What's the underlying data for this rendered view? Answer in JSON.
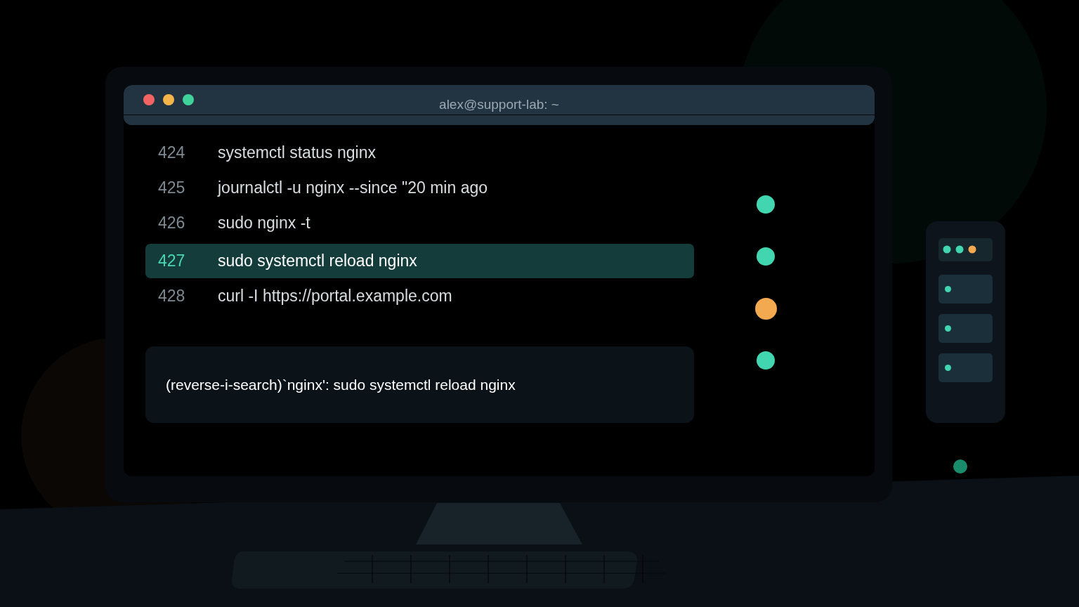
{
  "window": {
    "title": "alex@support-lab: ~"
  },
  "history": [
    {
      "number": "424",
      "command": "systemctl status nginx",
      "selected": false
    },
    {
      "number": "425",
      "command": "journalctl -u nginx --since \"20 min ago",
      "selected": false
    },
    {
      "number": "426",
      "command": "sudo nginx -t",
      "selected": false
    },
    {
      "number": "427",
      "command": "sudo systemctl reload nginx",
      "selected": true
    },
    {
      "number": "428",
      "command": "curl -I https://portal.example.com",
      "selected": false
    }
  ],
  "search": {
    "value": "(reverse-i-search)`nginx': sudo systemctl reload nginx"
  },
  "status_dots": [
    {
      "color": "#42d6b0"
    },
    {
      "color": "#42d6b0"
    },
    {
      "color": "#f2a950"
    },
    {
      "color": "#42d6b0"
    }
  ],
  "server": {
    "lights": [
      {
        "color": "#42d6b0"
      },
      {
        "color": "#42d6b0"
      },
      {
        "color": "#f2a950"
      }
    ],
    "drives": [
      {
        "color": "#42d6b0"
      },
      {
        "color": "#42d6b0"
      },
      {
        "color": "#42d6b0"
      }
    ]
  }
}
